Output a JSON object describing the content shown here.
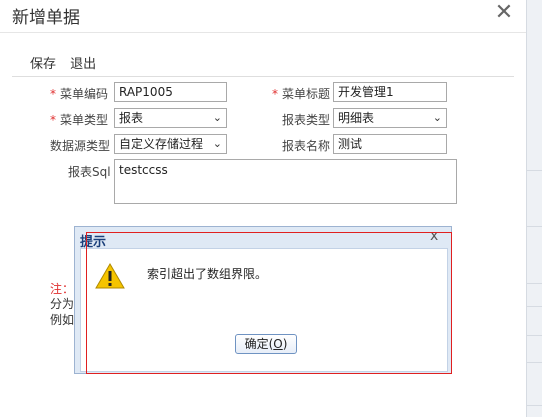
{
  "dialog": {
    "title": "新增单据",
    "close_symbol": "✕"
  },
  "toolbar": {
    "save_label": "保存",
    "exit_label": "退出"
  },
  "form": {
    "menu_code": {
      "label": "菜单编码",
      "required_mark": "*",
      "value": "RAP1005"
    },
    "menu_title": {
      "label": "菜单标题",
      "required_mark": "*",
      "value": "开发管理1"
    },
    "menu_type": {
      "label": "菜单类型",
      "required_mark": "*",
      "value": "报表"
    },
    "report_type": {
      "label": "报表类型",
      "value": "明细表"
    },
    "data_source_type": {
      "label": "数据源类型",
      "value": "自定义存储过程"
    },
    "report_name": {
      "label": "报表名称",
      "value": "测试"
    },
    "report_sql": {
      "label": "报表Sql",
      "value": "testccss"
    }
  },
  "notes": {
    "line1": "注：",
    "line2": "分为",
    "line3": "例如"
  },
  "alert": {
    "title": "提示",
    "close_symbol": "x",
    "message": "索引超出了数组界限。",
    "ok_text": "确定(",
    "ok_key": "O",
    "ok_suffix": ")",
    "icon": "warning-icon"
  },
  "colors": {
    "required": "#e03030",
    "alert_header": "#dfe9f5",
    "alert_title": "#1a3f7a",
    "highlight": "#e02020"
  }
}
